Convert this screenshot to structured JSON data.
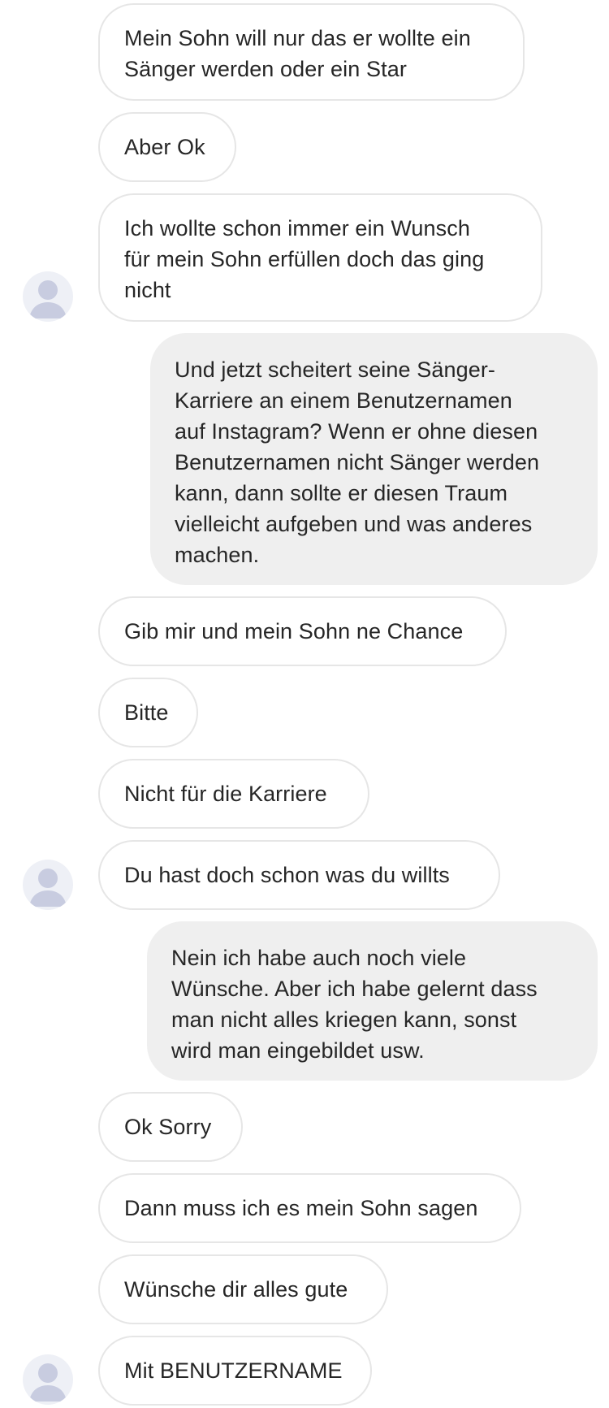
{
  "conversation": {
    "messages": [
      {
        "sender": "them",
        "text": "Mein Sohn will nur das er wollte ein\nSänger werden oder ein Star"
      },
      {
        "sender": "them",
        "text": "Aber Ok"
      },
      {
        "sender": "them",
        "text": "Ich wollte schon immer ein Wunsch\nfür mein Sohn erfüllen doch das ging\nnicht",
        "avatar": "user-avatar-icon"
      },
      {
        "sender": "me",
        "text": "Und jetzt scheitert seine Sänger-\nKarriere an einem Benutzernamen\nauf Instagram? Wenn er ohne diesen\nBenutzernamen nicht Sänger werden\nkann, dann sollte er diesen Traum\nvielleicht aufgeben und was anderes\nmachen."
      },
      {
        "sender": "them",
        "text": "Gib mir und mein Sohn ne Chance"
      },
      {
        "sender": "them",
        "text": "Bitte"
      },
      {
        "sender": "them",
        "text": "Nicht für die Karriere"
      },
      {
        "sender": "them",
        "text": "Du hast doch schon was du willts",
        "avatar": "user-avatar-icon"
      },
      {
        "sender": "me",
        "text": "Nein ich habe auch noch viele\nWünsche. Aber ich habe gelernt dass\nman nicht alles kriegen kann, sonst\nwird man eingebildet usw."
      },
      {
        "sender": "them",
        "text": "Ok Sorry"
      },
      {
        "sender": "them",
        "text": "Dann muss ich es mein Sohn sagen"
      },
      {
        "sender": "them",
        "text": "Wünsche dir alles gute"
      },
      {
        "sender": "them",
        "text": "Mit BENUTZERNAME",
        "avatar": "user-avatar-icon"
      }
    ]
  },
  "colors": {
    "incoming_bubble_bg": "#ffffff",
    "incoming_bubble_border": "#e6e6e6",
    "outgoing_bubble_bg": "#efefef",
    "text": "#262626",
    "avatar_bg": "#eef0f6",
    "avatar_figure": "#c8cce0"
  }
}
